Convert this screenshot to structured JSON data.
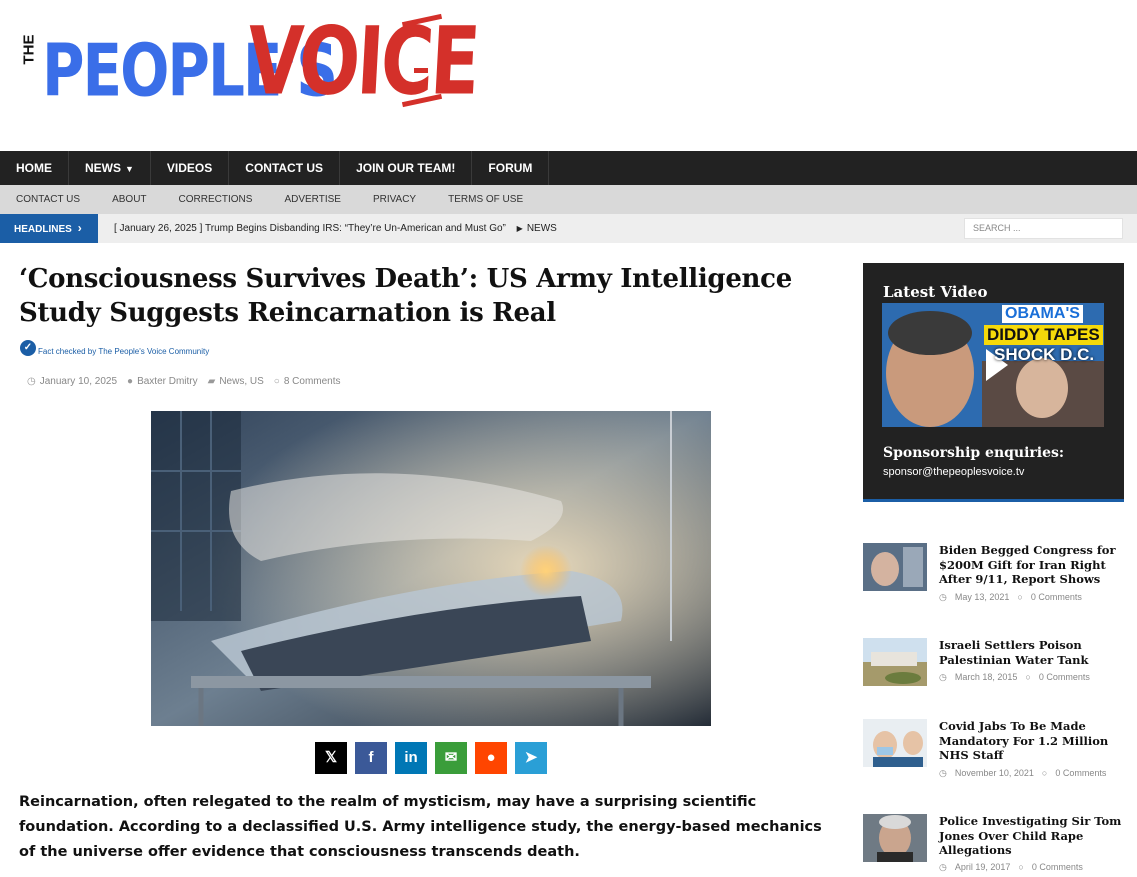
{
  "logo": {
    "the": "THE",
    "people": "PEOPLE'S",
    "voice": "VOICE"
  },
  "main_nav": {
    "home": "HOME",
    "news": "NEWS",
    "videos": "VIDEOS",
    "contact": "CONTACT US",
    "join": "JOIN OUR TEAM!",
    "forum": "FORUM"
  },
  "sub_nav": {
    "contact": "CONTACT US",
    "about": "ABOUT",
    "corrections": "CORRECTIONS",
    "advertise": "ADVERTISE",
    "privacy": "PRIVACY",
    "terms": "TERMS OF USE"
  },
  "headlines": {
    "label": "HEADLINES",
    "date": "[ January 26, 2025 ]",
    "text": "Trump Begins Disbanding IRS: “They’re Un-American and Must Go”",
    "category": "NEWS"
  },
  "search": {
    "placeholder": "SEARCH ..."
  },
  "article": {
    "title": "‘Consciousness Survives Death’: US Army Intelligence Study Suggests Reincarnation is Real",
    "fact_check": "Fact checked by The People's Voice Community",
    "date": "January 10, 2025",
    "author": "Baxter Dmitry",
    "categories": "News, US",
    "comments": "8 Comments",
    "lede": "Reincarnation, often relegated to the realm of mysticism, may have a surprising scientific foundation. According to a declassified U.S. Army intelligence study, the energy-based mechanics of the universe offer evidence that consciousness transcends death."
  },
  "share_buttons": [
    {
      "icon": "x-icon",
      "glyph": "𝕏",
      "color": "#000000"
    },
    {
      "icon": "facebook-icon",
      "glyph": "f",
      "color": "#3b5998"
    },
    {
      "icon": "linkedin-icon",
      "glyph": "in",
      "color": "#0077b5"
    },
    {
      "icon": "email-icon",
      "glyph": "✉",
      "color": "#3a9d3a"
    },
    {
      "icon": "reddit-icon",
      "glyph": "●",
      "color": "#ff4500"
    },
    {
      "icon": "telegram-icon",
      "glyph": "➤",
      "color": "#2a9fd6"
    }
  ],
  "sidebar": {
    "latest_video": "Latest Video",
    "video_caption": {
      "line1": "OBAMA'S",
      "line2": "DIDDY TAPES",
      "line3": "SHOCK D.C."
    },
    "sponsorship": "Sponsorship enquiries:",
    "email": "sponsor@thepeoplesvoice.tv",
    "posts": [
      {
        "title": "Biden Begged Congress for $200M Gift for Iran Right After 9/11, Report Shows",
        "date": "May 13, 2021",
        "comments": "0 Comments"
      },
      {
        "title": "Israeli Settlers Poison Palestinian Water Tank",
        "date": "March 18, 2015",
        "comments": "0 Comments"
      },
      {
        "title": "Covid Jabs To Be Made Mandatory For 1.2 Million NHS Staff",
        "date": "November 10, 2021",
        "comments": "0 Comments"
      },
      {
        "title": "Police Investigating Sir Tom Jones Over Child Rape Allegations",
        "date": "April 19, 2017",
        "comments": "0 Comments"
      }
    ]
  },
  "colors": {
    "brand_blue": "#3a6ee8",
    "brand_red": "#d4302a",
    "nav_dark": "#222222",
    "accent_blue": "#1b5ea6"
  }
}
